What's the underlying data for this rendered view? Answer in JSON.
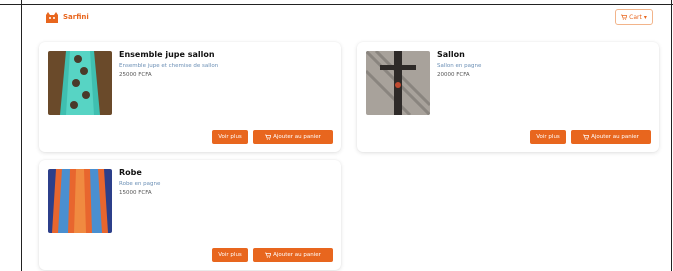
{
  "header": {
    "brand": "Sarfini",
    "cart_label": "Cart"
  },
  "products": [
    {
      "title": "Ensemble jupe sallon",
      "description": "Ensemble jupe et chemise de sallon",
      "price": "25000 FCFA",
      "view_label": "Voir plus",
      "add_label": "Ajouter au panier"
    },
    {
      "title": "Sallon",
      "description": "Sallon en pagne",
      "price": "20000 FCFA",
      "view_label": "Voir plus",
      "add_label": "Ajouter au panier"
    },
    {
      "title": "Robe",
      "description": "Robe en pagne",
      "price": "15000 FCFA",
      "view_label": "Voir plus",
      "add_label": "Ajouter au panier"
    }
  ],
  "colors": {
    "accent": "#e8661e",
    "link": "#6b8fb5"
  }
}
